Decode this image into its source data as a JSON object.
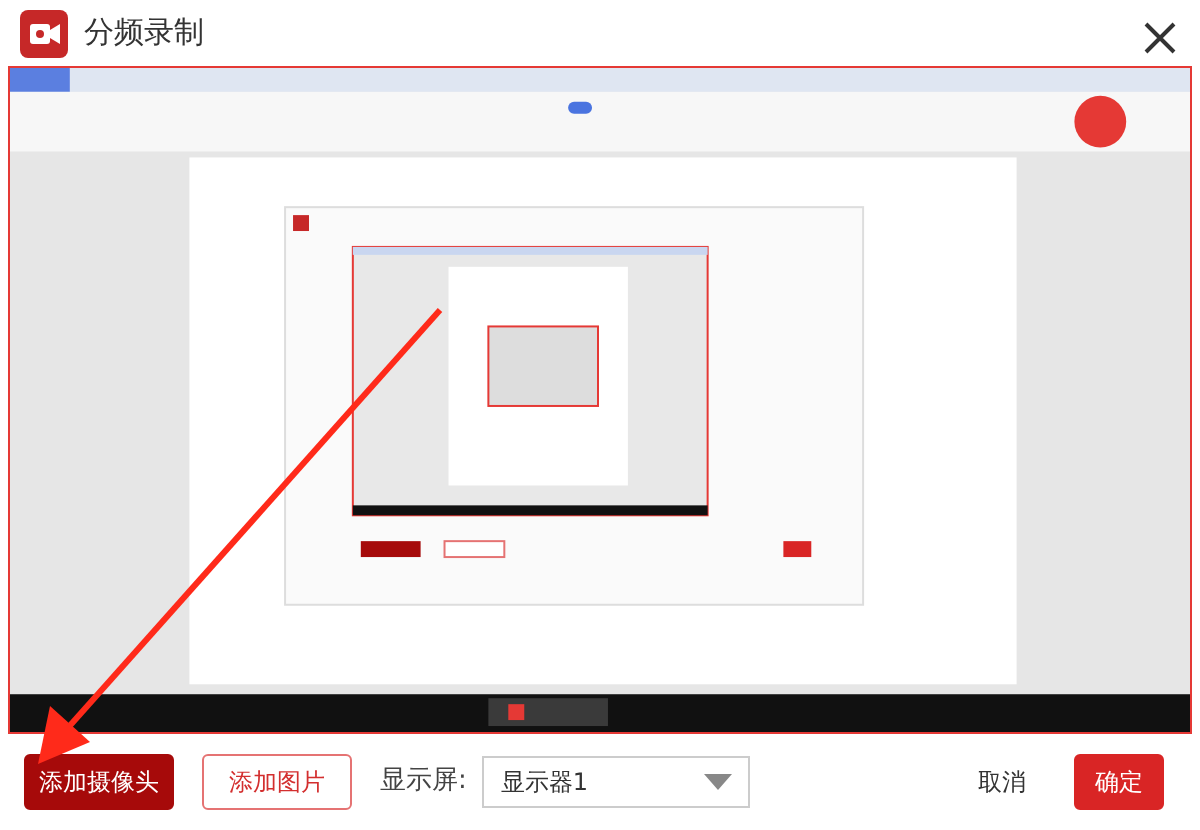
{
  "window": {
    "title": "分频录制"
  },
  "preview": {
    "selected": true
  },
  "buttons": [
    {
      "label": "添加摄像头",
      "kind": "primary"
    },
    {
      "label": "添加图片",
      "kind": "outline"
    }
  ],
  "display": {
    "label": "显示屏:",
    "value": "显示器1"
  },
  "actions": [
    {
      "label": "取消",
      "kind": "plain"
    },
    {
      "label": "确定",
      "kind": "danger"
    }
  ]
}
